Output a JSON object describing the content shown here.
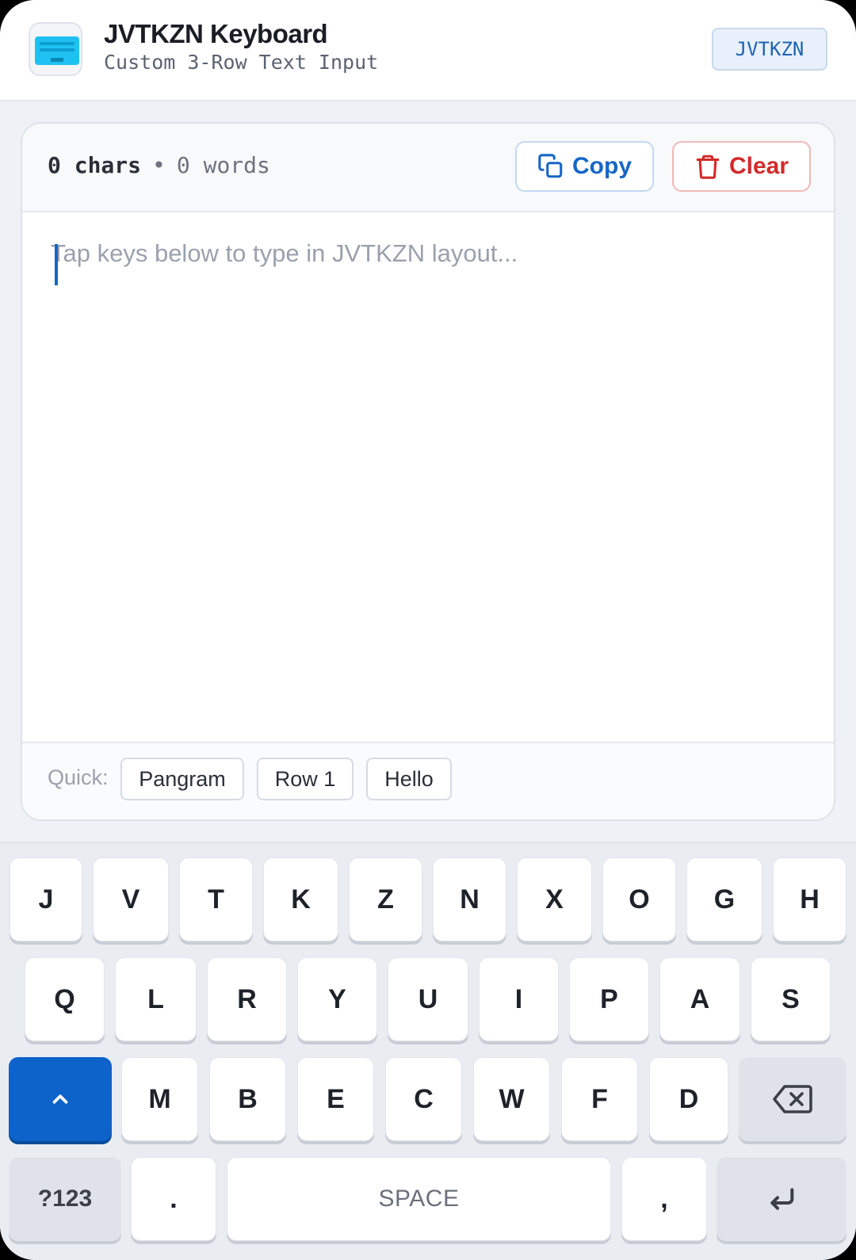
{
  "header": {
    "title": "JVTKZN Keyboard",
    "subtitle": "Custom 3-Row Text Input",
    "badge": "JVTKZN",
    "icon": "keyboard-icon"
  },
  "editor": {
    "chars_count": "0",
    "chars_label": "chars",
    "separator": "•",
    "words_count": "0",
    "words_label": "words",
    "copy_label": "Copy",
    "clear_label": "Clear",
    "placeholder": "Tap keys below to type in JVTKZN layout...",
    "value": ""
  },
  "quick": {
    "label": "Quick:",
    "items": [
      "Pangram",
      "Row 1",
      "Hello"
    ]
  },
  "keyboard": {
    "row1": [
      "J",
      "V",
      "T",
      "K",
      "Z",
      "N",
      "X",
      "O",
      "G",
      "H"
    ],
    "row2": [
      "Q",
      "L",
      "R",
      "Y",
      "U",
      "I",
      "P",
      "A",
      "S"
    ],
    "row3": [
      "M",
      "B",
      "E",
      "C",
      "W",
      "F",
      "D"
    ],
    "num_label": "?123",
    "period": ".",
    "space_label": "SPACE",
    "comma": ",",
    "shift_active": true
  },
  "colors": {
    "accent": "#1766c7",
    "danger": "#d42a2a",
    "shift": "#0d63c9"
  }
}
